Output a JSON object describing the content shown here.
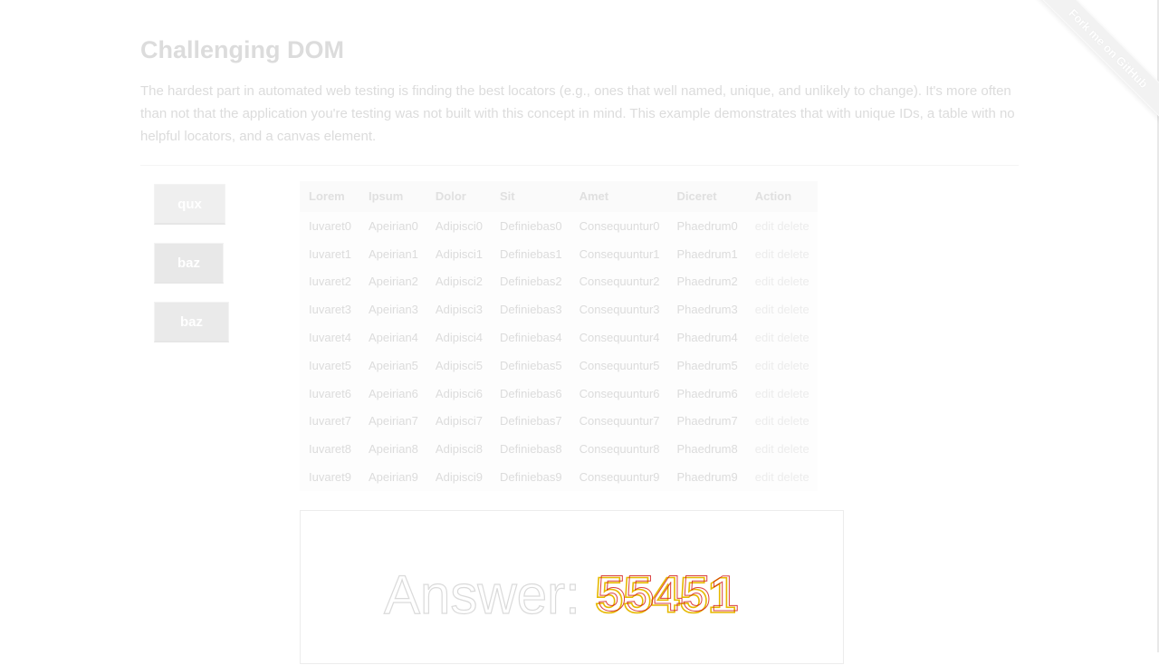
{
  "ribbon": {
    "label": "Fork me on GitHub"
  },
  "page": {
    "title": "Challenging DOM",
    "intro": "The hardest part in automated web testing is finding the best locators (e.g., ones that well named, unique, and unlikely to change). It's more often than not that the application you're testing was not built with this concept in mind. This example demonstrates that with unique IDs, a table with no helpful locators, and a canvas element."
  },
  "buttons": [
    {
      "label": "qux"
    },
    {
      "label": "baz"
    },
    {
      "label": "baz",
      "icon": "placeholder-glyph"
    }
  ],
  "table": {
    "headers": [
      "Lorem",
      "Ipsum",
      "Dolor",
      "Sit",
      "Amet",
      "Diceret",
      "Action"
    ],
    "rows": [
      [
        "Iuvaret0",
        "Apeirian0",
        "Adipisci0",
        "Definiebas0",
        "Consequuntur0",
        "Phaedrum0"
      ],
      [
        "Iuvaret1",
        "Apeirian1",
        "Adipisci1",
        "Definiebas1",
        "Consequuntur1",
        "Phaedrum1"
      ],
      [
        "Iuvaret2",
        "Apeirian2",
        "Adipisci2",
        "Definiebas2",
        "Consequuntur2",
        "Phaedrum2"
      ],
      [
        "Iuvaret3",
        "Apeirian3",
        "Adipisci3",
        "Definiebas3",
        "Consequuntur3",
        "Phaedrum3"
      ],
      [
        "Iuvaret4",
        "Apeirian4",
        "Adipisci4",
        "Definiebas4",
        "Consequuntur4",
        "Phaedrum4"
      ],
      [
        "Iuvaret5",
        "Apeirian5",
        "Adipisci5",
        "Definiebas5",
        "Consequuntur5",
        "Phaedrum5"
      ],
      [
        "Iuvaret6",
        "Apeirian6",
        "Adipisci6",
        "Definiebas6",
        "Consequuntur6",
        "Phaedrum6"
      ],
      [
        "Iuvaret7",
        "Apeirian7",
        "Adipisci7",
        "Definiebas7",
        "Consequuntur7",
        "Phaedrum7"
      ],
      [
        "Iuvaret8",
        "Apeirian8",
        "Adipisci8",
        "Definiebas8",
        "Consequuntur8",
        "Phaedrum8"
      ],
      [
        "Iuvaret9",
        "Apeirian9",
        "Adipisci9",
        "Definiebas9",
        "Consequuntur9",
        "Phaedrum9"
      ]
    ],
    "edit_label": "edit",
    "delete_label": "delete"
  },
  "canvas": {
    "answer_label": "Answer:",
    "answer_value": "55451",
    "answer_color": "#e6b800",
    "answer_outline_color": "#d11111"
  }
}
